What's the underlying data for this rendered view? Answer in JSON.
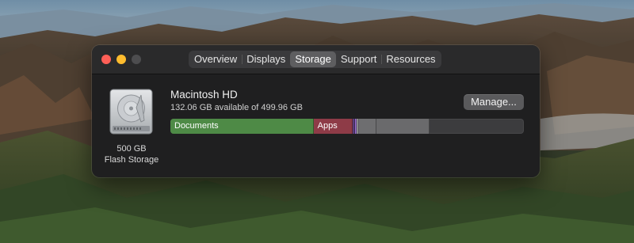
{
  "window": {
    "tabs": [
      {
        "label": "Overview",
        "active": false
      },
      {
        "label": "Displays",
        "active": false
      },
      {
        "label": "Storage",
        "active": true
      },
      {
        "label": "Support",
        "active": false
      },
      {
        "label": "Resources",
        "active": false
      }
    ]
  },
  "disk": {
    "icon": "hard-drive-icon",
    "size_label": "500 GB",
    "type_label": "Flash Storage"
  },
  "volume": {
    "name": "Macintosh HD",
    "availability": "132.06 GB available of 499.96 GB",
    "manage_label": "Manage..."
  },
  "storage_bar": {
    "segments": [
      {
        "label": "Documents",
        "color": "#4e8a46",
        "fraction": 0.405
      },
      {
        "label": "Apps",
        "color": "#8e3b47",
        "fraction": 0.11
      },
      {
        "label": "",
        "color": "#5a3d7a",
        "fraction": 0.007
      },
      {
        "label": "",
        "color": "#9a6fcf",
        "fraction": 0.006
      },
      {
        "label": "",
        "color": "#8a8a8c",
        "fraction": 0.006
      },
      {
        "label": "",
        "color": "#6e6e70",
        "fraction": 0.05
      },
      {
        "label": "",
        "color": "#6a6a6c",
        "fraction": 0.15
      }
    ],
    "free_color": "#3c3c3e"
  },
  "colors": {
    "close": "#fe5f57",
    "minimize": "#febc2e",
    "zoom_disabled": "#4d4d4f"
  }
}
